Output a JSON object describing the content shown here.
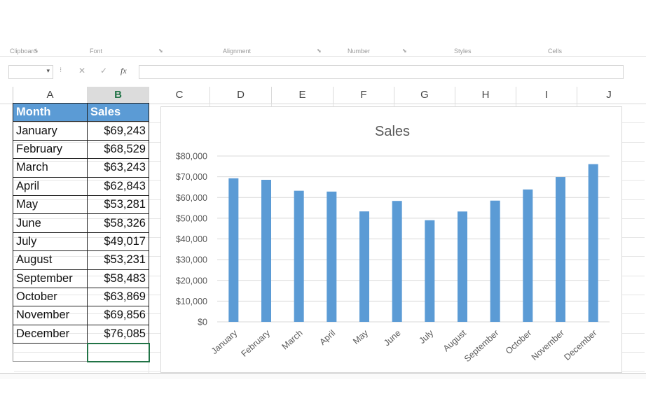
{
  "ribbon": {
    "groups": [
      "Clipboard",
      "Font",
      "Alignment",
      "Number",
      "Styles",
      "Cells"
    ]
  },
  "formula_bar": {
    "name_box": "",
    "cancel_icon": "✕",
    "enter_icon": "✓",
    "fx_label": "fx",
    "formula": ""
  },
  "columns": [
    "A",
    "B",
    "C",
    "D",
    "E",
    "F",
    "G",
    "H",
    "I",
    "J"
  ],
  "selected_column": "B",
  "table": {
    "headers": [
      "Month",
      "Sales"
    ],
    "rows": [
      [
        "January",
        "$69,243"
      ],
      [
        "February",
        "$68,529"
      ],
      [
        "March",
        "$63,243"
      ],
      [
        "April",
        "$62,843"
      ],
      [
        "May",
        "$53,281"
      ],
      [
        "June",
        "$58,326"
      ],
      [
        "July",
        "$49,017"
      ],
      [
        "August",
        "$53,231"
      ],
      [
        "September",
        "$58,483"
      ],
      [
        "October",
        "$63,869"
      ],
      [
        "November",
        "$69,856"
      ],
      [
        "December",
        "$76,085"
      ]
    ]
  },
  "colors": {
    "bar": "#5b9bd5",
    "header_fill": "#5b9bd5",
    "selection": "#217346"
  },
  "chart_data": {
    "type": "bar",
    "title": "Sales",
    "categories": [
      "January",
      "February",
      "March",
      "April",
      "May",
      "June",
      "July",
      "August",
      "September",
      "October",
      "November",
      "December"
    ],
    "values": [
      69243,
      68529,
      63243,
      62843,
      53281,
      58326,
      49017,
      53231,
      58483,
      63869,
      69856,
      76085
    ],
    "ylim": [
      0,
      80000
    ],
    "yticks": [
      "$0",
      "$10,000",
      "$20,000",
      "$30,000",
      "$40,000",
      "$50,000",
      "$60,000",
      "$70,000",
      "$80,000"
    ],
    "grid": true,
    "legend": "none"
  }
}
